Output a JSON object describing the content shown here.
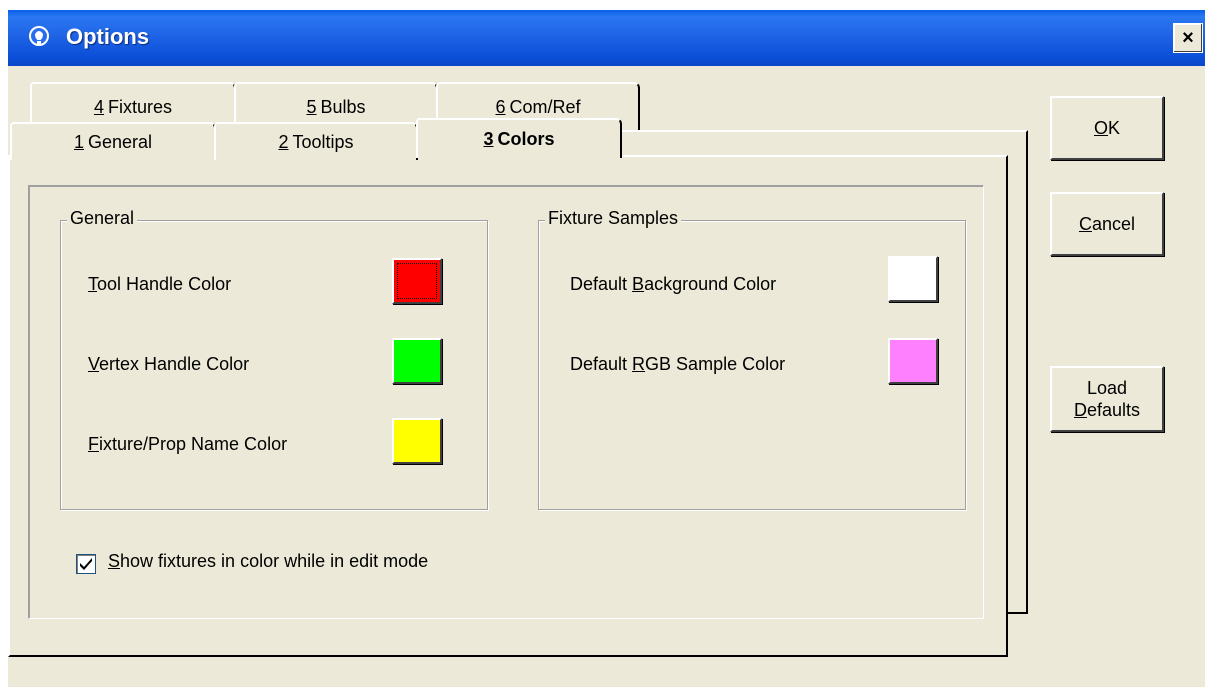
{
  "window": {
    "title": "Options",
    "close_glyph": "×"
  },
  "tabs": {
    "row_back": [
      {
        "num": "4",
        "label": "Fixtures"
      },
      {
        "num": "5",
        "label": "Bulbs"
      },
      {
        "num": "6",
        "label": "Com/Ref"
      }
    ],
    "row_front": [
      {
        "num": "1",
        "label": "General"
      },
      {
        "num": "2",
        "label": "Tooltips"
      },
      {
        "num": "3",
        "label": "Colors"
      }
    ],
    "active": "3 Colors"
  },
  "general_group": {
    "label": "General",
    "rows": [
      {
        "mnemonic": "T",
        "rest": "ool Handle Color",
        "color": "#ff0000"
      },
      {
        "mnemonic": "V",
        "rest": "ertex Handle Color",
        "color": "#00ff00"
      },
      {
        "mnemonic": "F",
        "rest": "ixture/Prop Name Color",
        "color": "#ffff00"
      }
    ]
  },
  "fixture_group": {
    "label": "Fixture Samples",
    "rows": [
      {
        "pre": "Default ",
        "mnemonic": "B",
        "rest": "ackground Color",
        "color": "#ffffff"
      },
      {
        "pre": "Default ",
        "mnemonic": "R",
        "rest": "GB Sample Color",
        "color": "#ff80ff"
      }
    ]
  },
  "checkbox": {
    "checked": true,
    "mnemonic": "S",
    "rest": "how fixtures in color while in edit mode"
  },
  "buttons": {
    "ok": {
      "mnemonic": "O",
      "rest": "K"
    },
    "cancel": {
      "mnemonic": "C",
      "rest": "ancel"
    },
    "load_defaults": {
      "line1": "Load",
      "mnemonic": "D",
      "rest": "efaults"
    }
  },
  "colors": {
    "titlebar": "#0b4ed8",
    "dialog_bg": "#ece9d8"
  },
  "icons": {
    "title": "lightbulb-icon",
    "close": "close-icon",
    "check": "checkmark-icon"
  }
}
